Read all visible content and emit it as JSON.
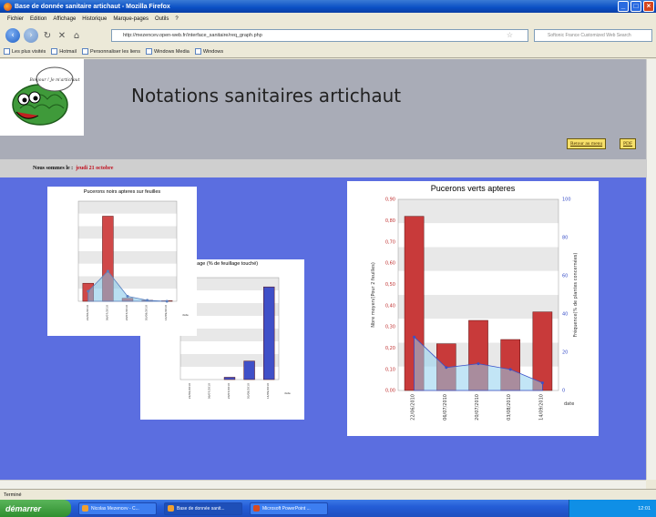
{
  "window": {
    "title": "Base de donnée sanitaire artichaut - Mozilla Firefox"
  },
  "menu": [
    "Fichier",
    "Edition",
    "Affichage",
    "Historique",
    "Marque-pages",
    "Outils",
    "?"
  ],
  "url": "http://mezencev.open-web.fr/interface_sanitaire/req_graph.php",
  "search_placeholder": "Softonic France Customized Web Search",
  "bookmarks": [
    "Les plus visités",
    "Hotmail",
    "Personnaliser les liens",
    "Windows Media",
    "Windows"
  ],
  "logo_text": "Bonjour ! Je m'artichaut",
  "page": {
    "title": "Notations sanitaires artichaut",
    "back_label": "Retour au menu",
    "pdf_label": "PDF",
    "date_prefix": "Nous sommes le :",
    "date_value": "jeudi 21 octobre"
  },
  "chart_data": [
    {
      "type": "bar",
      "title": "Pucerons noirs apteres sur feuilles",
      "categories": [
        "22/06/2010",
        "06/07/2010",
        "20/07/2010",
        "03/08/2010",
        "14/09/2010"
      ],
      "values": [
        0.18,
        0.85,
        0.03,
        0.01,
        0.005
      ],
      "secondary_values": [
        10,
        30,
        5,
        1,
        0
      ],
      "ylim": [
        0,
        1.0
      ],
      "y2lim": [
        0,
        100
      ],
      "xlabel": "date",
      "colors": {
        "bar": "#d04848",
        "area": "#7fc4e8"
      }
    },
    {
      "type": "bar",
      "title": "feuillage (% de feuillage touché)",
      "categories": [
        "22/06/2010",
        "06/07/2010",
        "20/07/2010",
        "03/08/2010",
        "14/09/2010"
      ],
      "values": [
        0,
        0,
        0.5,
        4,
        20
      ],
      "xlabel": "date",
      "colors": {
        "bar": "#4050c8"
      }
    },
    {
      "type": "bar",
      "title": "Pucerons verts apteres",
      "categories": [
        "22/06/2010",
        "06/07/2010",
        "20/07/2010",
        "03/08/2010",
        "14/09/2010"
      ],
      "values": [
        0.82,
        0.22,
        0.33,
        0.24,
        0.37
      ],
      "secondary_values": [
        28,
        12,
        14,
        11,
        4
      ],
      "ylim": [
        0,
        0.9
      ],
      "y2lim": [
        0,
        100
      ],
      "yticks": [
        "0,00",
        "0,10",
        "0,20",
        "0,30",
        "0,40",
        "0,50",
        "0,60",
        "0,70",
        "0,80",
        "0,90"
      ],
      "y2ticks": [
        "0",
        "20",
        "40",
        "60",
        "80",
        "100"
      ],
      "ylabel": "Nbre moyen/(Pour 2 feuilles)",
      "y2label": "Fréquence(% de plantes concernées)",
      "xlabel": "date",
      "colors": {
        "bar": "#c83a3a",
        "area": "#8fd0ee",
        "line": "#3a50c8"
      }
    }
  ],
  "status_text": "Terminé",
  "taskbar": {
    "start_label": "démarrer",
    "tasks": [
      "Nicolas Mezencev - C...",
      "Base de donnée sanit...",
      "Microsoft PowerPoint ..."
    ],
    "clock": "12:01"
  }
}
